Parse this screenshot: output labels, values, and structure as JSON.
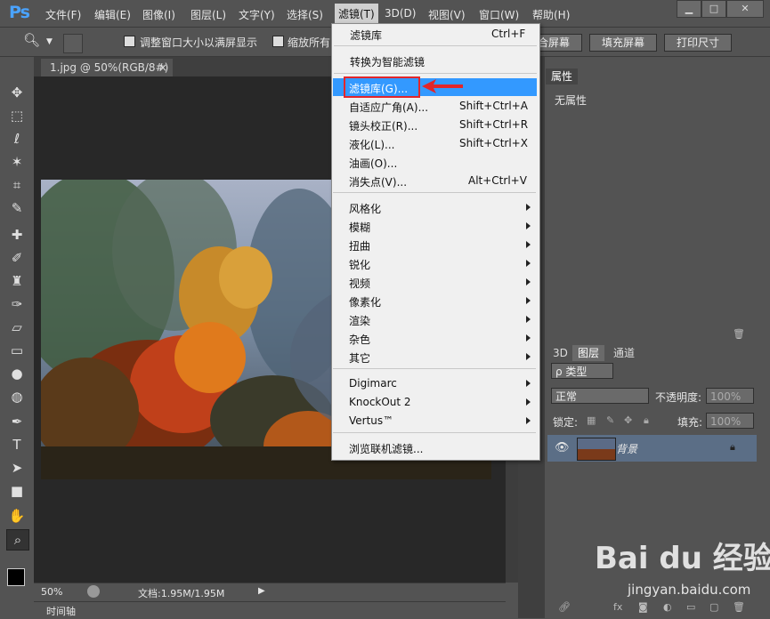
{
  "app": {
    "logo": "Ps"
  },
  "menubar": {
    "items": [
      "文件(F)",
      "编辑(E)",
      "图像(I)",
      "图层(L)",
      "文字(Y)",
      "选择(S)",
      "滤镜(T)",
      "3D(D)",
      "视图(V)",
      "窗口(W)",
      "帮助(H)"
    ]
  },
  "window_controls": {
    "minimize": "▁",
    "maximize": "□",
    "close": "✕"
  },
  "options": {
    "resize_windows": "调整窗口大小以满屏显示",
    "zoom_all": "缩放所有",
    "fit_screen": "合屏幕",
    "fill_screen": "填充屏幕",
    "print_size": "打印尺寸"
  },
  "document": {
    "tab_title": "1.jpg @ 50%(RGB/8#)",
    "tab_close": "×",
    "zoom": "50%",
    "doc_size": "文档:1.95M/1.95M",
    "timeline": "时间轴"
  },
  "filter_menu": {
    "last_filter": {
      "label": "滤镜库",
      "shortcut": "Ctrl+F"
    },
    "smart": "转换为智能滤镜",
    "items_top": [
      {
        "label": "滤镜库(G)...",
        "shortcut": ""
      },
      {
        "label": "自适应广角(A)...",
        "shortcut": "Shift+Ctrl+A"
      },
      {
        "label": "镜头校正(R)...",
        "shortcut": "Shift+Ctrl+R"
      },
      {
        "label": "液化(L)...",
        "shortcut": "Shift+Ctrl+X"
      },
      {
        "label": "油画(O)...",
        "shortcut": ""
      },
      {
        "label": "消失点(V)...",
        "shortcut": "Alt+Ctrl+V"
      }
    ],
    "submenus": [
      "风格化",
      "模糊",
      "扭曲",
      "锐化",
      "视频",
      "像素化",
      "渲染",
      "杂色",
      "其它"
    ],
    "plugins": [
      "Digimarc",
      "KnockOut 2",
      "Vertus™"
    ],
    "browse": "浏览联机滤镜..."
  },
  "properties_panel": {
    "tab": "属性",
    "content": "无属性"
  },
  "layers_panel": {
    "tabs": [
      "3D",
      "图层",
      "通道"
    ],
    "kind_filter": "ρ 类型",
    "blend_mode": "正常",
    "opacity_label": "不透明度:",
    "opacity_value": "100%",
    "lock_label": "锁定:",
    "fill_label": "填充:",
    "fill_value": "100%",
    "layer_name": "背景"
  },
  "watermark": {
    "logo": "Bai du 经验",
    "url": "jingyan.baidu.com"
  },
  "colors": {
    "accent": "#3399ff",
    "highlight_box": "#e2262b",
    "ps_blue": "#4aa3ff"
  }
}
